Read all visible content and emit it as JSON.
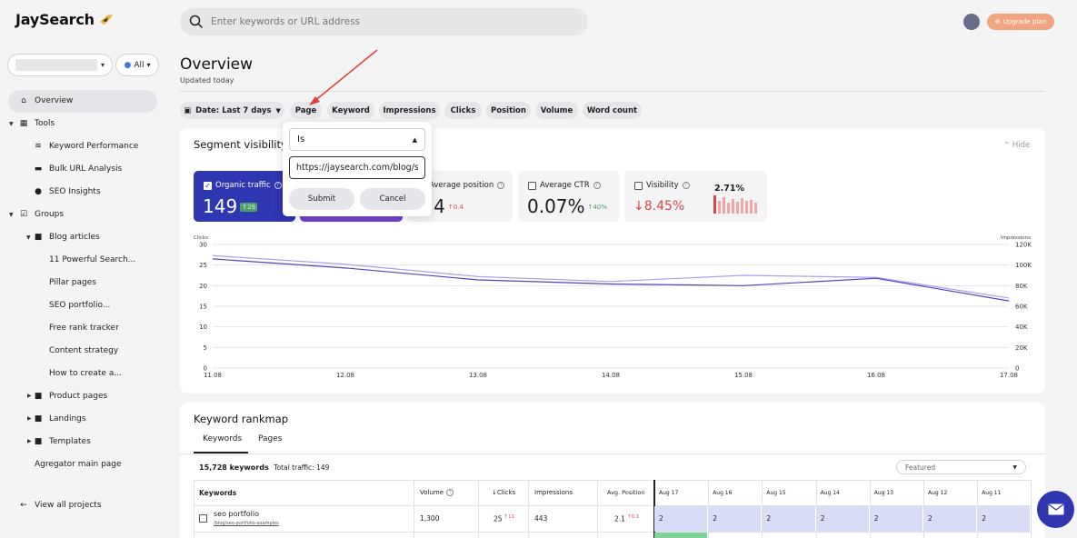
{
  "app": {
    "name": "JaySearch"
  },
  "search": {
    "placeholder": "Enter keywords or URL address"
  },
  "header": {
    "upgrade_label": "Upgrade plan"
  },
  "project": {
    "filter_label": "All"
  },
  "sidebar": {
    "overview": "Overview",
    "tools": "Tools",
    "tool_items": [
      "Keyword Performance",
      "Bulk URL Analysis",
      "SEO Insights"
    ],
    "groups": "Groups",
    "blog_articles": "Blog articles",
    "blog_items": [
      "11 Powerful Search...",
      "Pillar pages",
      "SEO portfolio...",
      "Free rank tracker",
      "Content strategy",
      "How to create a..."
    ],
    "other_groups": [
      "Product pages",
      "Landings",
      "Templates"
    ],
    "aggregator": "Agregator main page",
    "view_all": "View all projects"
  },
  "page": {
    "title": "Overview",
    "subtitle": "Updated today"
  },
  "filters": {
    "date_label": "Date:",
    "date_value": "Last 7 days",
    "chips": [
      "Page",
      "Keyword",
      "Impressions",
      "Clicks",
      "Position",
      "Volume",
      "Word count"
    ]
  },
  "popup": {
    "operator": "Is",
    "url_value": "https://jaysearch.com/blog/se",
    "submit": "Submit",
    "cancel": "Cancel"
  },
  "segment": {
    "title": "Segment visibility",
    "hide": "Hide",
    "metrics": {
      "organic": {
        "label": "Organic traffic",
        "value": "149",
        "delta": "29"
      },
      "position": {
        "label": "Average position",
        "value": "5.4",
        "delta": "0.4"
      },
      "ctr": {
        "label": "Average CTR",
        "value": "0.07%",
        "delta": "40%"
      },
      "visibility": {
        "label": "Visibility",
        "value": "8.45%",
        "spark_value": "2.71%"
      }
    }
  },
  "chart_data": {
    "type": "line",
    "x": [
      "11.08",
      "12.08",
      "13.08",
      "14.08",
      "15.08",
      "16.08",
      "17.08"
    ],
    "series": [
      {
        "values": [
          27.3,
          25.2,
          22.2,
          21.0,
          22.5,
          22.0,
          17.0
        ]
      },
      {
        "values": [
          26.5,
          24.3,
          21.4,
          20.4,
          20.0,
          21.8,
          16.3
        ]
      }
    ],
    "ylabel": "Clicks",
    "y2label": "Impressions",
    "ylim": [
      0,
      30
    ],
    "y_ticks": [
      "0",
      "5",
      "10",
      "15",
      "20",
      "25",
      "30"
    ],
    "y2_ticks": [
      "0",
      "20K",
      "40K",
      "60K",
      "80K",
      "100K",
      "120K"
    ],
    "colors": [
      "#a7a2ec",
      "#5a3fc0"
    ]
  },
  "rankmap": {
    "title": "Keyword rankmap",
    "tabs": [
      "Keywords",
      "Pages"
    ],
    "count": "15,728 keywords",
    "traffic": "Total traffic: 149",
    "sort": "Featured",
    "columns": [
      "Keywords",
      "Volume",
      "Clicks",
      "Impressions",
      "Avg. Position"
    ],
    "dates": [
      "Aug 17",
      "Aug 16",
      "Aug 15",
      "Aug 14",
      "Aug 13",
      "Aug 12",
      "Aug 11"
    ],
    "row": {
      "keyword": "seo portfolio",
      "url": "/blog/seo-portfolio-examples",
      "volume": "1,300",
      "clicks": "25",
      "clicks_delta": "11",
      "impressions": "443",
      "position": "2.1",
      "position_delta": "0.1",
      "positions": [
        "2",
        "2",
        "2",
        "2",
        "2",
        "2",
        "2"
      ]
    }
  }
}
